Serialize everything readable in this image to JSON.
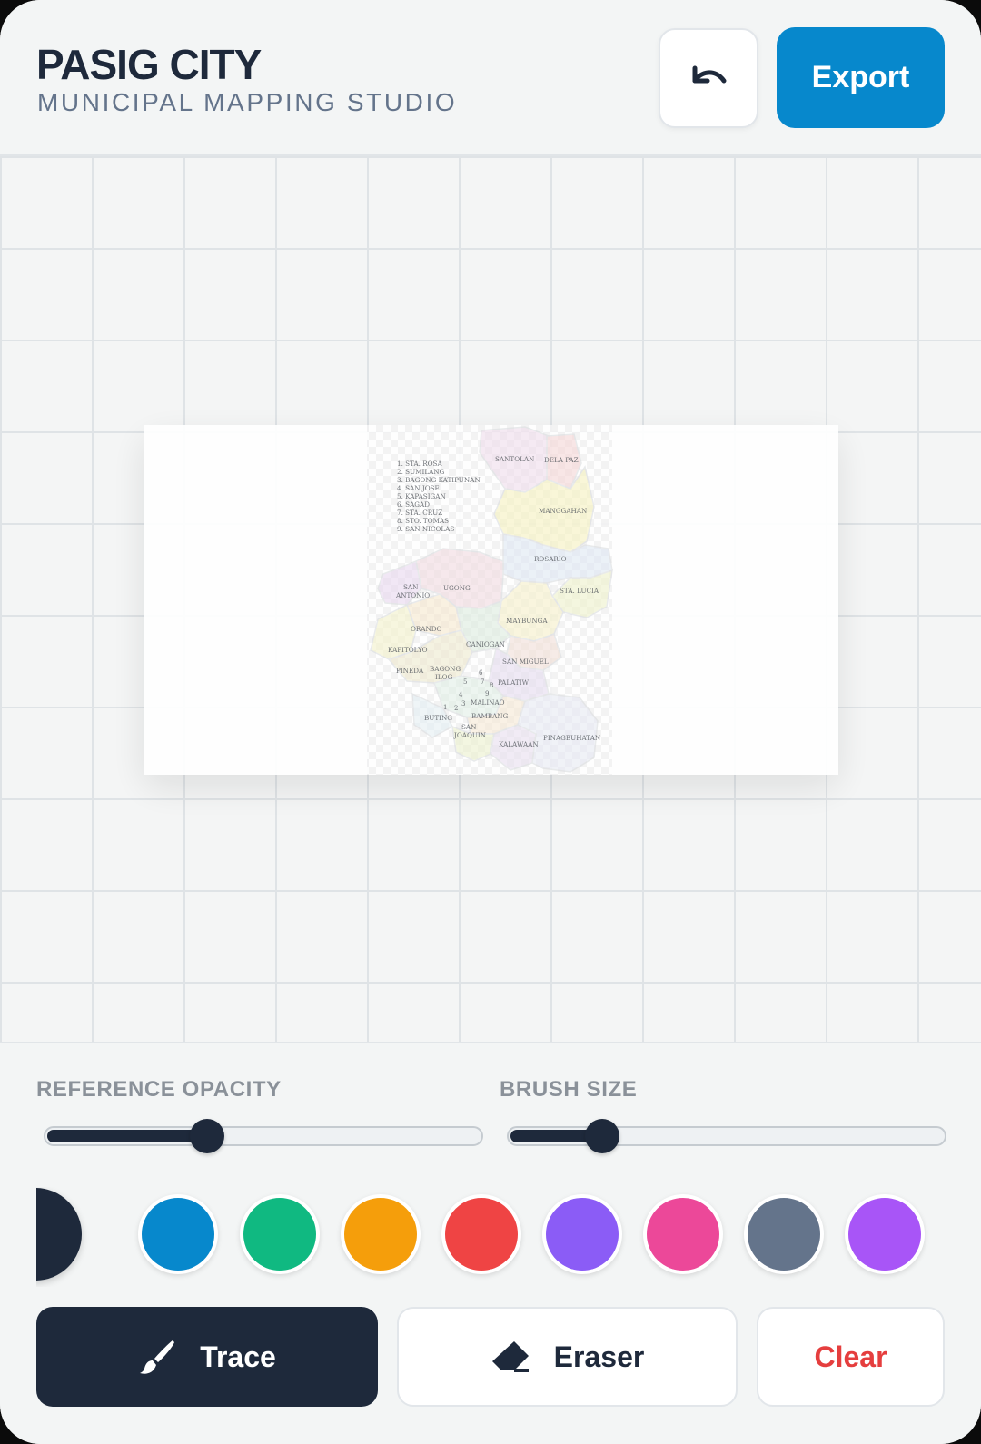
{
  "header": {
    "title": "PASIG CITY",
    "subtitle": "MUNICIPAL MAPPING STUDIO",
    "undo_icon": "undo-icon",
    "export_label": "Export"
  },
  "reference_map": {
    "legend": [
      "1. STA. ROSA",
      "2. SUMILANG",
      "3. BAGONG KATIPUNAN",
      "4. SAN JOSE",
      "5. KAPASIGAN",
      "6. SAGAD",
      "7. STA. CRUZ",
      "8. STO. TOMAS",
      "9. SAN NICOLAS"
    ],
    "barangays": [
      "SANTOLAN",
      "DELA PAZ",
      "MANGGAHAN",
      "ROSARIO",
      "SAN",
      "ANTONIO",
      "UGONG",
      "STA. LUCIA",
      "MAYBUNGA",
      "ORANDO",
      "KAPITOLYO",
      "CANIOGAN",
      "SAN MIGUEL",
      "PINEDA",
      "BAGONG",
      "ILOG",
      "PALATIW",
      "MALINAO",
      "BAMBANG",
      "BUTING",
      "SAN",
      "JOAQUIN",
      "KALAWAAN",
      "PINAGBUHATAN"
    ],
    "numbers": [
      "6",
      "5",
      "7",
      "8",
      "4",
      "9",
      "3",
      "1",
      "2"
    ]
  },
  "controls": {
    "opacity_label": "REFERENCE OPACITY",
    "opacity_value": 0.36,
    "brush_label": "BRUSH SIZE",
    "brush_value": 0.19
  },
  "palette": {
    "colors": [
      "#1e293b",
      "#0788cc",
      "#10b981",
      "#f59e0b",
      "#ef4444",
      "#8b5cf6",
      "#ec4899",
      "#64748b",
      "#a855f7"
    ],
    "selected": 0
  },
  "tools": {
    "trace_label": "Trace",
    "trace_icon": "brush-icon",
    "eraser_label": "Eraser",
    "eraser_icon": "eraser-icon",
    "clear_label": "Clear",
    "active": "trace"
  }
}
